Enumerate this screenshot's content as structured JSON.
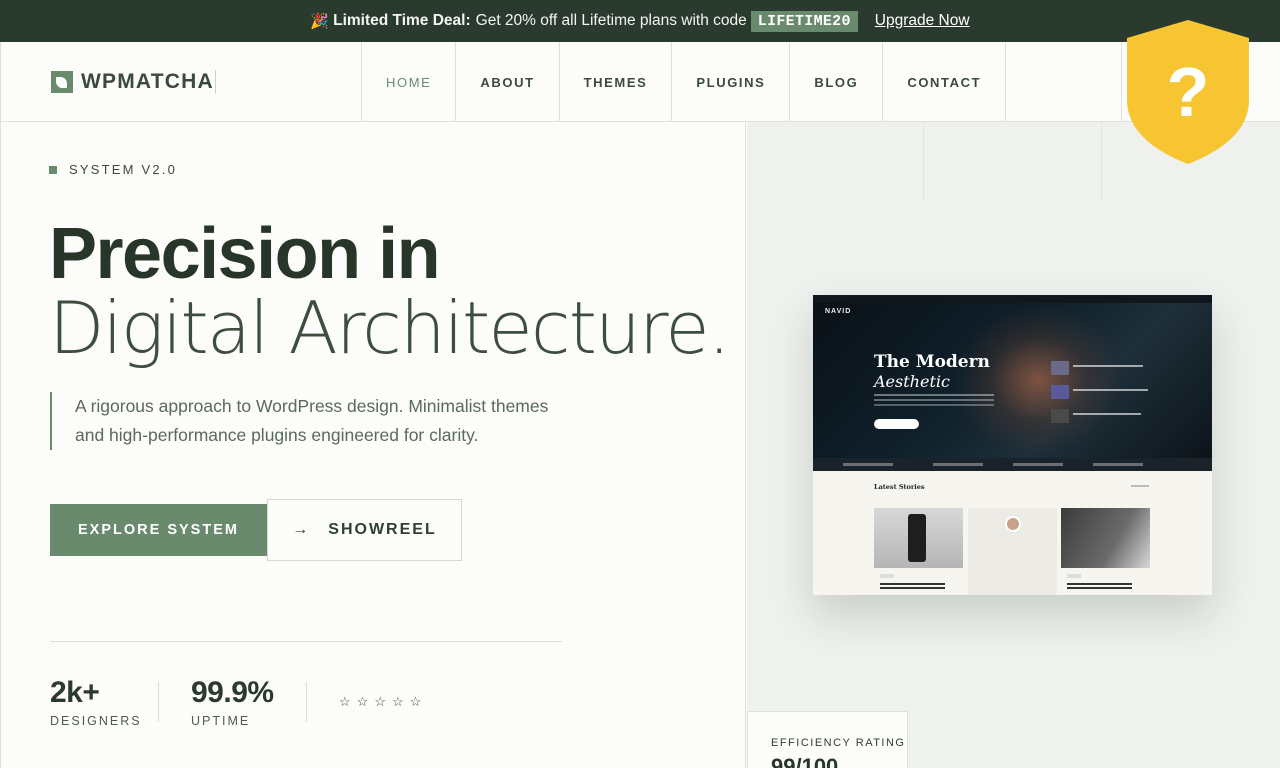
{
  "promo": {
    "emoji": "🎉",
    "label": "Limited Time Deal:",
    "text": "Get 20% off all Lifetime plans with code",
    "code": "LIFETIME20",
    "cta": "Upgrade Now"
  },
  "header": {
    "logo_text": "WPMATCHA",
    "nav": [
      "HOME",
      "ABOUT",
      "THEMES",
      "PLUGINS",
      "BLOG",
      "CONTACT"
    ],
    "active_nav": "HOME"
  },
  "hero": {
    "eyebrow": "SYSTEM V2.0",
    "title_line1": "Precision in",
    "title_line2": "Digital Architecture.",
    "lead": "A rigorous approach to WordPress design. Minimalist themes and high-performance plugins engineered for clarity.",
    "primary_cta": "EXPLORE SYSTEM",
    "secondary_cta": "SHOWREEL",
    "stats": [
      {
        "value": "2k+",
        "label": "DESIGNERS"
      },
      {
        "value": "99.9%",
        "label": "UPTIME"
      }
    ],
    "rating_stars": 5,
    "stars_glyph": "☆"
  },
  "preview": {
    "brand": "NAVID",
    "title1": "The Modern",
    "title2": "Aesthetic",
    "latest_label": "Latest Stories"
  },
  "efficiency": {
    "label": "EFFICIENCY RATING",
    "value": "99/100"
  },
  "badge": {
    "icon": "question-mark-shield-icon",
    "glyph": "?",
    "color": "#f7c532"
  },
  "colors": {
    "accent": "#6a8a6e",
    "dark": "#2b3a2e"
  }
}
